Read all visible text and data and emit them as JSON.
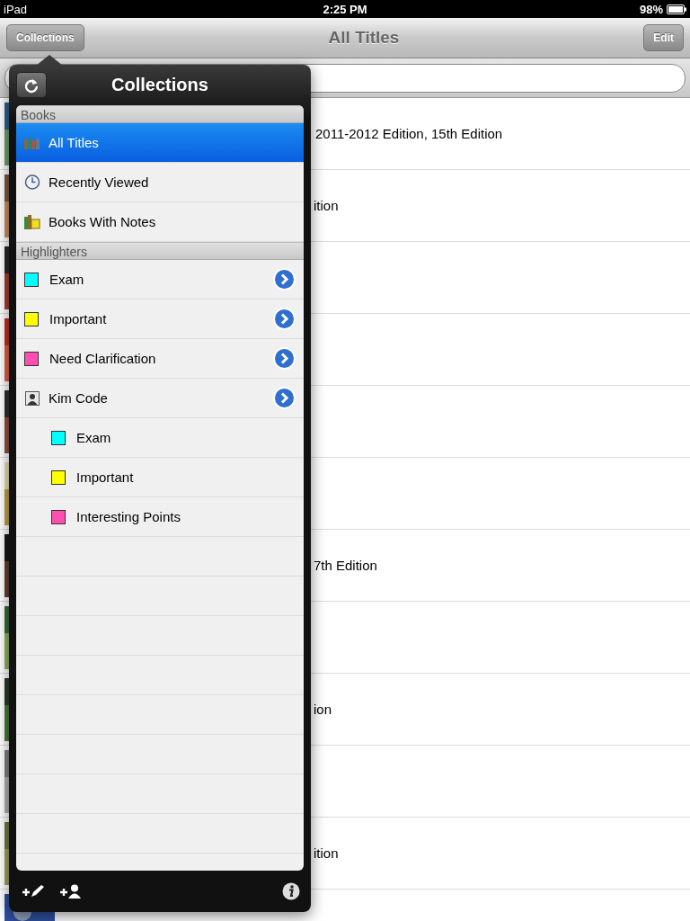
{
  "status_bar": {
    "device": "iPad",
    "time": "2:25 PM",
    "battery": "98%"
  },
  "nav_bar": {
    "left_button": "Collections",
    "title": "All Titles",
    "right_button": "Edit"
  },
  "list": {
    "rows": [
      {
        "thumbnail": {
          "kind": "picture"
        },
        "title": "2011-2012 Edition, 15th Edition"
      },
      {
        "thumbnail": {
          "kind": "picture"
        },
        "title": "ition"
      },
      {
        "thumbnail": {
          "kind": "picture"
        }
      },
      {
        "thumbnail": {
          "kind": "picture"
        }
      },
      {
        "thumbnail": {
          "kind": "picture"
        }
      },
      {
        "thumbnail": {
          "kind": "picture"
        }
      },
      {
        "thumbnail": {
          "kind": "picture"
        },
        "title": "7th Edition"
      },
      {
        "thumbnail": {
          "kind": "picture"
        }
      },
      {
        "thumbnail": {
          "kind": "picture"
        },
        "title": "ion"
      },
      {
        "thumbnail": {
          "kind": "picture"
        }
      },
      {
        "thumbnail": {
          "kind": "picture"
        },
        "title": "ition"
      },
      {
        "thumbnail": {
          "kind": "picture"
        }
      }
    ]
  },
  "popover": {
    "title": "Collections",
    "sections": [
      {
        "header": "Books",
        "items": [
          {
            "label": "All Titles",
            "kind": "shelf",
            "selected": true,
            "disclosure": false
          },
          {
            "label": "Recently Viewed",
            "kind": "clock",
            "selected": false,
            "disclosure": false
          },
          {
            "label": "Books With Notes",
            "kind": "notes",
            "selected": false,
            "disclosure": false
          }
        ]
      },
      {
        "header": "Highlighters",
        "items": [
          {
            "label": "Exam",
            "kind": "swatch",
            "color": "#00ffff",
            "selected": false,
            "disclosure": true
          },
          {
            "label": "Important",
            "kind": "swatch",
            "color": "#ffff00",
            "selected": false,
            "disclosure": true
          },
          {
            "label": "Need Clarification",
            "kind": "swatch",
            "color": "#ff4fb0",
            "selected": false,
            "disclosure": true
          },
          {
            "label": "Kim Code",
            "kind": "person",
            "selected": false,
            "disclosure": true,
            "children": [
              {
                "label": "Exam",
                "kind": "swatch",
                "color": "#00ffff",
                "selected": false,
                "disclosure": false
              },
              {
                "label": "Important",
                "kind": "swatch",
                "color": "#ffff00",
                "selected": false,
                "disclosure": false
              },
              {
                "label": "Interesting Points",
                "kind": "swatch",
                "color": "#ff4fb0",
                "selected": false,
                "disclosure": false
              }
            ]
          }
        ]
      }
    ]
  }
}
